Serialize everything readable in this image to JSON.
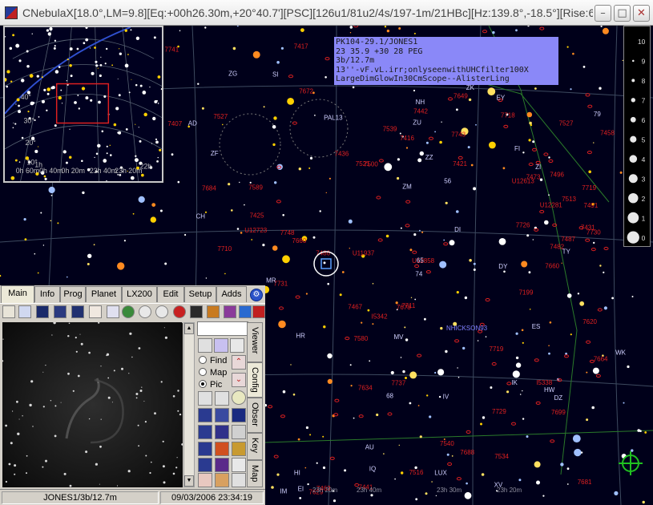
{
  "window": {
    "title": "CNebulaX[18.0°,LM=9.8][Eq:+00h26.30m,+20°40.7'][PSC][126u1/81u2/4s/197-1m/21HBc][Hz:139.8°,-18.5°][Rise:6h5…",
    "buttons": {
      "minimize": "–",
      "maximize": "□",
      "close": "✕"
    }
  },
  "info_box": {
    "lines": [
      "PK104-29.1/JONES1",
      "23 35.9 +30 28 PEG",
      "3b/12.7m",
      "13''-vF.vL.irr;onlyseenwithUHCfilter100X",
      "LargeDimGlowIn30CmScope--AlisterLing"
    ]
  },
  "magnitude_legend": {
    "values": [
      "10",
      "9",
      "8",
      "7",
      "6",
      "5",
      "4",
      "3",
      "2",
      "1",
      "0"
    ]
  },
  "sky_labels": {
    "ngc": [
      "7741",
      "7726",
      "7719",
      "7743",
      "7731",
      "7730",
      "7748",
      "7660",
      "7634",
      "7620",
      "7629",
      "7672",
      "7718",
      "U12723",
      "7710",
      "7664",
      "7660",
      "7540",
      "7527",
      "7500",
      "7711",
      "7539",
      "7678",
      "7458",
      "7496",
      "7416",
      "U12858",
      "7516",
      "7688",
      "7463",
      "7473",
      "U11937",
      "7441",
      "7436",
      "7431",
      "7442",
      "7719",
      "7699",
      "7681",
      "7684",
      "7729",
      "7737",
      "U12613",
      "7649",
      "7589",
      "7580",
      "7521",
      "7513",
      "7527",
      "U12281",
      "7534",
      "7407",
      "7417",
      "7421",
      "I5338",
      "7487",
      "7199",
      "7482",
      "7425",
      "I5342",
      "7467",
      "7486",
      "7491"
    ],
    "bright_stars": [
      "79",
      "68",
      "56",
      "65",
      "74",
      "ZU",
      "NH",
      "ZI",
      "SI",
      "ES",
      "WK",
      "ZG",
      "AD",
      "CH",
      "IV",
      "ZF",
      "ZM",
      "EI",
      "FI",
      "ZK",
      "IQ",
      "HW",
      "MV",
      "MR",
      "DY",
      "HR",
      "IM",
      "ZZ",
      "HI",
      "AU",
      "XV",
      "TY",
      "DI",
      "IK",
      "EY",
      "DZ",
      "LUX",
      "PAL13"
    ],
    "ra_ticks": [
      "23h 20m",
      "23h 40m",
      "23h 30m",
      "23h 20m"
    ],
    "highlighted": [
      "NHICKSON93"
    ]
  },
  "overview": {
    "labels": [
      "40°",
      "30°",
      "20°",
      "10°",
      "0h 60m",
      "1h",
      "0h 40m",
      "0h 20m",
      "23h 40m",
      "23h 20m",
      "22h"
    ]
  },
  "tabs": [
    "Main",
    "Info",
    "Prog",
    "Planet",
    "LX200",
    "Edit",
    "Setup",
    "Adds"
  ],
  "side_panel": {
    "object_input": "",
    "radios": [
      {
        "label": "Find",
        "checked": false
      },
      {
        "label": "Map",
        "checked": false
      },
      {
        "label": "Pic",
        "checked": true
      }
    ],
    "vertical_tabs": [
      "Viewer",
      "Config",
      "Obser",
      "Key",
      "Map"
    ]
  },
  "status": {
    "object": "JONES1/3b/12.7m",
    "datetime": "09/03/2006 23:34:19"
  },
  "colors": {
    "sky": "#00001a",
    "grid": "#445566",
    "ngc_red": "#e02020",
    "star_yellow": "#ffd000",
    "info_bg": "#8a88f8"
  }
}
